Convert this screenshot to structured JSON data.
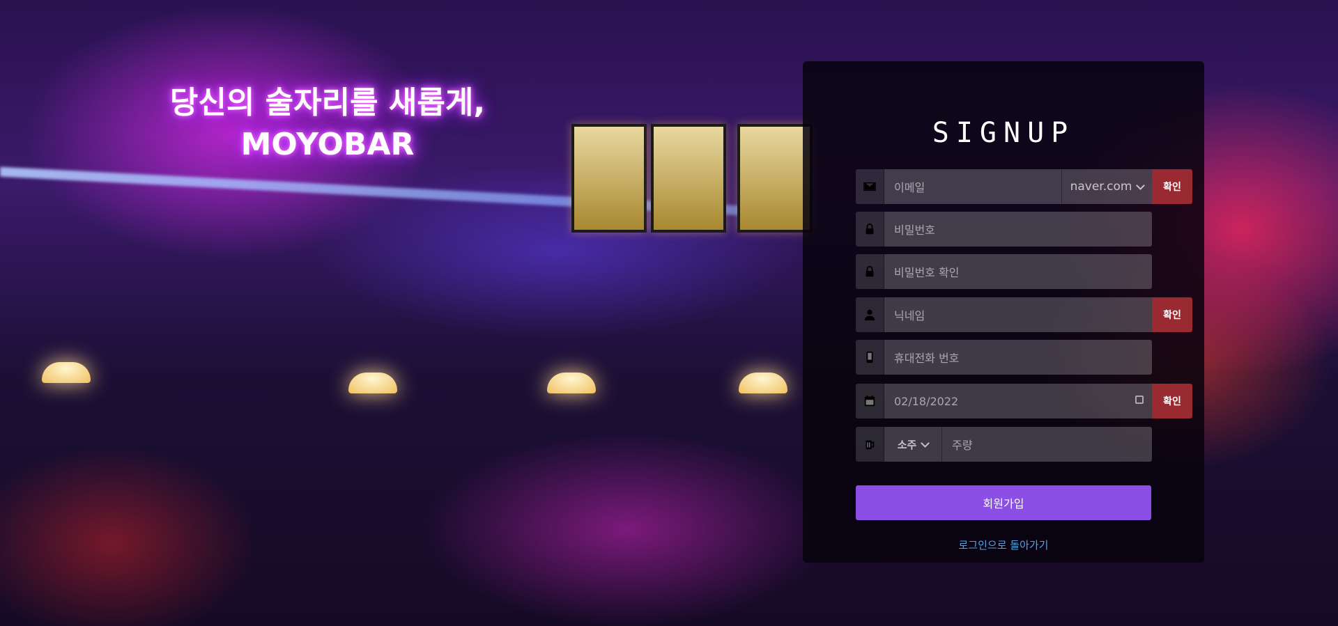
{
  "hero": {
    "line1": "당신의 술자리를 새롭게,",
    "line2": "MOYOBAR"
  },
  "signup": {
    "title": "SIGNUP",
    "email": {
      "placeholder": "이메일",
      "domain": "naver.com",
      "confirm": "확인",
      "icon": "envelope-icon"
    },
    "password": {
      "placeholder": "비밀번호",
      "icon": "lock-icon"
    },
    "password_confirm": {
      "placeholder": "비밀번호 확인",
      "icon": "lock-icon"
    },
    "nickname": {
      "placeholder": "닉네임",
      "confirm": "확인",
      "icon": "user-icon"
    },
    "phone": {
      "placeholder": "휴대전화 번호",
      "icon": "mobile-icon"
    },
    "birthdate": {
      "value": "02/18/2022",
      "confirm": "확인",
      "icon": "calendar-icon"
    },
    "drink": {
      "type": "소주",
      "placeholder": "주량",
      "icon": "beer-mug-icon"
    },
    "submit": "회원가입",
    "back_link": "로그인으로 돌아가기"
  },
  "colors": {
    "confirm": "#9a2a32",
    "submit": "#8b4fe6",
    "link": "#4ea6e8"
  }
}
